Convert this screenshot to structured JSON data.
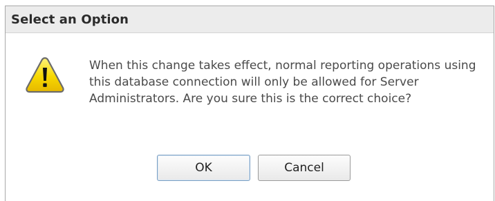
{
  "dialog": {
    "title": "Select an Option",
    "icon": "warning-icon",
    "message": "When this change takes effect, normal reporting operations using this database connection will only be allowed for Server Administrators. Are you sure this is the correct choice?",
    "buttons": {
      "ok_label": "OK",
      "cancel_label": "Cancel"
    }
  },
  "colors": {
    "title_bar": "#ececec",
    "warning_fill": "#f5d000",
    "warning_border": "#6b6b6b",
    "ok_focus_border": "#7a9ec2"
  }
}
